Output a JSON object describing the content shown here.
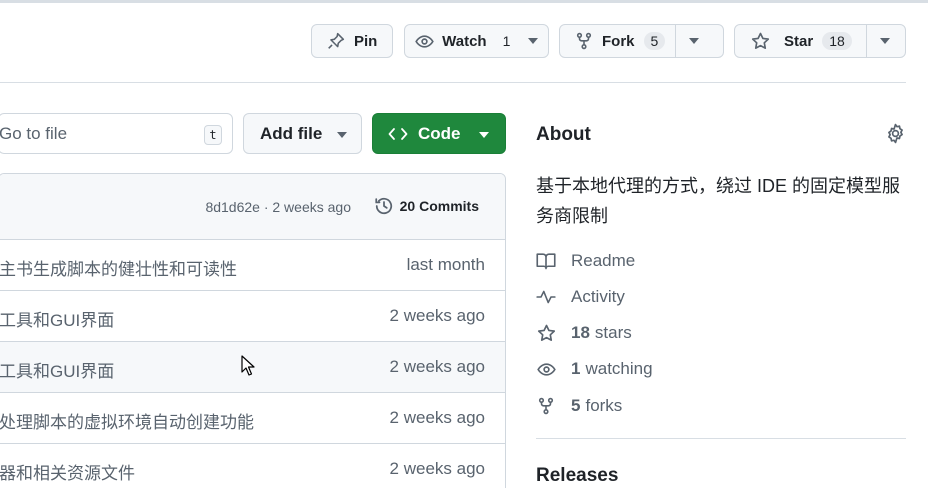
{
  "header": {
    "pin": {
      "label": "Pin",
      "icon": "pin-icon"
    },
    "watch": {
      "label": "Watch",
      "count": "1",
      "icon": "eye-icon"
    },
    "fork": {
      "label": "Fork",
      "count": "5",
      "icon": "repo-forked-icon"
    },
    "star": {
      "label": "Star",
      "count": "18",
      "icon": "star-icon"
    }
  },
  "toolbar": {
    "search_placeholder": "Go to file",
    "search_shortcut": "t",
    "add_file_label": "Add file",
    "code_label": "Code"
  },
  "commit_bar": {
    "hash_text": "8d1d62e · 2 weeks ago",
    "commits_label": "20 Commits"
  },
  "files": [
    {
      "message": "主书生成脚本的健壮性和可读性",
      "time": "last month"
    },
    {
      "message": "工具和GUI界面",
      "time": "2 weeks ago"
    },
    {
      "message": "工具和GUI界面",
      "time": "2 weeks ago"
    },
    {
      "message": "处理脚本的虚拟环境自动创建功能",
      "time": "2 weeks ago"
    },
    {
      "message": "器和相关资源文件",
      "time": "2 weeks ago"
    }
  ],
  "about": {
    "title": "About",
    "description": "基于本地代理的方式，绕过 IDE 的固定模型服务商限制",
    "readme": "Readme",
    "activity": "Activity",
    "stars_count": "18",
    "stars_label": "stars",
    "watching_count": "1",
    "watching_label": "watching",
    "forks_count": "5",
    "forks_label": "forks"
  },
  "releases": {
    "title": "Releases"
  },
  "colors": {
    "accent_green": "#1f883d",
    "border": "#d0d7de",
    "muted": "#59636e"
  }
}
